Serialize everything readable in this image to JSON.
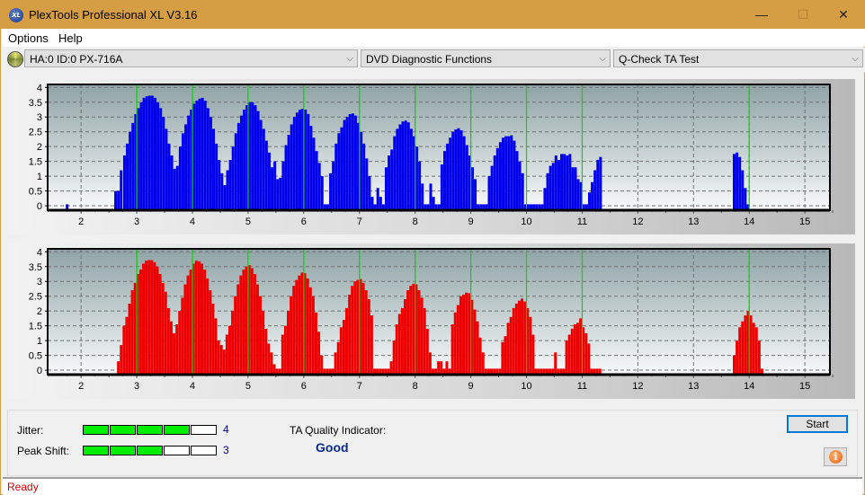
{
  "window": {
    "title": "PlexTools Professional XL V3.16",
    "app_icon_text": "XL",
    "minimize_glyph": "—",
    "maximize_glyph": "☐",
    "close_glyph": "✕",
    "titlebar_color": "#d59d44"
  },
  "menu": {
    "items": [
      {
        "label": "Options"
      },
      {
        "label": "Help"
      }
    ]
  },
  "toolbar": {
    "drive_select": {
      "value": "HA:0 ID:0  PX-716A"
    },
    "function_select": {
      "value": "DVD Diagnostic Functions"
    },
    "test_select": {
      "value": "Q-Check TA Test"
    },
    "chevron_glyph": "⌵"
  },
  "chart_data": [
    {
      "type": "bar",
      "title": "",
      "xlabel": "",
      "ylabel": "",
      "xlim": [
        1.4,
        15.45
      ],
      "ylim": [
        -0.15,
        4.1
      ],
      "x_ticks": [
        2,
        3,
        4,
        5,
        6,
        7,
        8,
        9,
        10,
        11,
        12,
        13,
        14,
        15
      ],
      "y_ticks": [
        0,
        0.5,
        1,
        1.5,
        2,
        2.5,
        3,
        3.5,
        4
      ],
      "y_tick_labels": [
        "0",
        "0.5",
        "1",
        "1.5",
        "2",
        "2.5",
        "3",
        "3.5",
        "4"
      ],
      "grid": true,
      "bar_color": "#0000ee",
      "reference_lines": [
        3,
        4,
        5,
        6,
        7,
        8,
        9,
        10,
        11,
        14
      ],
      "reference_line_color": "#00dd00",
      "series": [
        {
          "name": "Jitter distribution (blue)",
          "x": [
            1.75,
            2.62,
            2.67,
            2.72,
            2.78,
            2.83,
            2.88,
            2.93,
            2.98,
            3.03,
            3.08,
            3.13,
            3.18,
            3.23,
            3.28,
            3.33,
            3.38,
            3.43,
            3.48,
            3.53,
            3.58,
            3.63,
            3.68,
            3.73,
            3.78,
            3.83,
            3.88,
            3.93,
            3.98,
            4.03,
            4.08,
            4.13,
            4.18,
            4.23,
            4.28,
            4.33,
            4.38,
            4.43,
            4.48,
            4.53,
            4.58,
            4.63,
            4.68,
            4.73,
            4.78,
            4.83,
            4.88,
            4.93,
            4.98,
            5.03,
            5.08,
            5.13,
            5.18,
            5.23,
            5.28,
            5.33,
            5.38,
            5.43,
            5.48,
            5.53,
            5.58,
            5.63,
            5.68,
            5.73,
            5.78,
            5.83,
            5.88,
            5.93,
            5.98,
            6.03,
            6.08,
            6.13,
            6.18,
            6.23,
            6.28,
            6.33,
            6.38,
            6.43,
            6.48,
            6.53,
            6.58,
            6.63,
            6.68,
            6.73,
            6.78,
            6.83,
            6.88,
            6.93,
            6.98,
            7.03,
            7.08,
            7.13,
            7.18,
            7.23,
            7.28,
            7.33,
            7.38,
            7.43,
            7.48,
            7.53,
            7.58,
            7.63,
            7.68,
            7.73,
            7.78,
            7.83,
            7.88,
            7.93,
            7.98,
            8.03,
            8.08,
            8.13,
            8.18,
            8.23,
            8.28,
            8.33,
            8.38,
            8.43,
            8.48,
            8.53,
            8.58,
            8.63,
            8.68,
            8.73,
            8.78,
            8.83,
            8.88,
            8.93,
            8.98,
            9.03,
            9.08,
            9.13,
            9.18,
            9.23,
            9.28,
            9.33,
            9.38,
            9.43,
            9.48,
            9.53,
            9.58,
            9.63,
            9.68,
            9.73,
            9.78,
            9.83,
            9.88,
            9.93,
            9.98,
            10.03,
            10.08,
            10.13,
            10.18,
            10.23,
            10.28,
            10.33,
            10.38,
            10.43,
            10.48,
            10.53,
            10.58,
            10.63,
            10.68,
            10.73,
            10.78,
            10.83,
            10.88,
            10.93,
            10.98,
            11.03,
            11.08,
            11.13,
            11.18,
            11.23,
            11.28,
            11.33,
            13.73,
            13.78,
            13.83,
            13.88,
            13.93,
            13.98,
            14.03,
            14.08,
            14.13,
            14.18,
            14.23
          ],
          "values": [
            0.05,
            0.5,
            0.5,
            1.2,
            1.7,
            2.1,
            2.5,
            2.8,
            3.1,
            3.3,
            3.5,
            3.65,
            3.7,
            3.72,
            3.72,
            3.65,
            3.5,
            3.3,
            3.0,
            2.6,
            2.1,
            1.7,
            1.25,
            1.35,
            2.0,
            2.45,
            2.75,
            3.05,
            3.25,
            3.45,
            3.55,
            3.62,
            3.65,
            3.55,
            3.3,
            3.0,
            2.6,
            2.1,
            1.55,
            1.1,
            0.7,
            1.2,
            1.55,
            2.0,
            2.45,
            2.8,
            3.05,
            3.25,
            3.4,
            3.5,
            3.5,
            3.4,
            3.2,
            2.9,
            2.6,
            2.2,
            1.8,
            1.3,
            1.5,
            0.9,
            0.95,
            1.5,
            2.05,
            2.4,
            2.75,
            3.0,
            3.15,
            3.25,
            3.28,
            3.25,
            3.1,
            2.7,
            2.3,
            1.85,
            1.45,
            1.0,
            0.05,
            0.05,
            1.1,
            1.5,
            2.1,
            2.45,
            2.65,
            2.9,
            3.0,
            3.1,
            3.12,
            3.05,
            2.8,
            2.5,
            2.1,
            1.6,
            1.0,
            0.3,
            0.05,
            0.6,
            0.3,
            0.05,
            1.3,
            1.7,
            1.9,
            2.35,
            2.6,
            2.75,
            2.85,
            2.88,
            2.82,
            2.6,
            2.35,
            2.0,
            1.5,
            0.75,
            0.05,
            0.05,
            0.75,
            0.3,
            0.05,
            0.05,
            1.4,
            1.85,
            2.1,
            2.3,
            2.5,
            2.58,
            2.62,
            2.55,
            2.35,
            2.05,
            1.7,
            1.3,
            0.9,
            0.05,
            0.05,
            0.05,
            0.05,
            1.0,
            1.35,
            1.7,
            1.95,
            2.15,
            2.3,
            2.35,
            2.35,
            2.38,
            2.2,
            1.85,
            1.5,
            1.1,
            0.05,
            0.05,
            0.05,
            0.05,
            0.05,
            0.05,
            0.05,
            0.6,
            1.1,
            1.35,
            1.45,
            1.7,
            1.55,
            1.75,
            1.75,
            1.7,
            1.75,
            1.3,
            1.3,
            0.9,
            0.8,
            0.05,
            0.05,
            0.45,
            0.8,
            1.2,
            1.55,
            1.65,
            1.75,
            1.8,
            1.65,
            1.2,
            0.6,
            0.05
          ]
        }
      ]
    },
    {
      "type": "bar",
      "title": "",
      "xlabel": "",
      "ylabel": "",
      "xlim": [
        1.4,
        15.45
      ],
      "ylim": [
        -0.15,
        4.1
      ],
      "x_ticks": [
        2,
        3,
        4,
        5,
        6,
        7,
        8,
        9,
        10,
        11,
        12,
        13,
        14,
        15
      ],
      "y_ticks": [
        0,
        0.5,
        1,
        1.5,
        2,
        2.5,
        3,
        3.5,
        4
      ],
      "y_tick_labels": [
        "0",
        "0.5",
        "1",
        "1.5",
        "2",
        "2.5",
        "3",
        "3.5",
        "4"
      ],
      "grid": true,
      "bar_color": "#ee0000",
      "reference_lines": [
        3,
        4,
        5,
        6,
        7,
        8,
        9,
        10,
        11,
        14
      ],
      "reference_line_color": "#00dd00",
      "series": [
        {
          "name": "Peak shift distribution (red)",
          "x": [
            2.67,
            2.72,
            2.77,
            2.82,
            2.87,
            2.92,
            2.97,
            3.02,
            3.07,
            3.12,
            3.17,
            3.22,
            3.27,
            3.32,
            3.37,
            3.42,
            3.47,
            3.52,
            3.57,
            3.62,
            3.67,
            3.72,
            3.77,
            3.82,
            3.87,
            3.92,
            3.97,
            4.02,
            4.07,
            4.12,
            4.17,
            4.22,
            4.27,
            4.32,
            4.37,
            4.42,
            4.47,
            4.52,
            4.57,
            4.62,
            4.67,
            4.72,
            4.77,
            4.82,
            4.87,
            4.92,
            4.97,
            5.02,
            5.07,
            5.12,
            5.17,
            5.22,
            5.27,
            5.32,
            5.37,
            5.42,
            5.47,
            5.52,
            5.57,
            5.62,
            5.67,
            5.72,
            5.77,
            5.82,
            5.87,
            5.92,
            5.97,
            6.02,
            6.07,
            6.12,
            6.17,
            6.22,
            6.27,
            6.32,
            6.37,
            6.42,
            6.47,
            6.52,
            6.57,
            6.62,
            6.67,
            6.72,
            6.77,
            6.82,
            6.87,
            6.92,
            6.97,
            7.02,
            7.07,
            7.12,
            7.17,
            7.22,
            7.27,
            7.32,
            7.37,
            7.42,
            7.47,
            7.52,
            7.57,
            7.62,
            7.67,
            7.72,
            7.77,
            7.82,
            7.87,
            7.92,
            7.97,
            8.02,
            8.07,
            8.12,
            8.17,
            8.22,
            8.27,
            8.32,
            8.37,
            8.42,
            8.47,
            8.52,
            8.57,
            8.62,
            8.67,
            8.72,
            8.77,
            8.82,
            8.87,
            8.92,
            8.97,
            9.02,
            9.07,
            9.12,
            9.17,
            9.22,
            9.27,
            9.32,
            9.37,
            9.42,
            9.47,
            9.52,
            9.57,
            9.62,
            9.67,
            9.72,
            9.77,
            9.82,
            9.87,
            9.92,
            9.97,
            10.02,
            10.07,
            10.12,
            10.17,
            10.22,
            10.27,
            10.32,
            10.37,
            10.42,
            10.47,
            10.52,
            10.57,
            10.62,
            10.67,
            10.72,
            10.77,
            10.82,
            10.87,
            10.92,
            10.97,
            11.02,
            11.07,
            11.12,
            11.17,
            11.22,
            11.27,
            11.32,
            13.73,
            13.78,
            13.83,
            13.88,
            13.93,
            13.98,
            14.03,
            14.08,
            14.13,
            14.18,
            14.23
          ],
          "values": [
            0.3,
            0.85,
            1.5,
            1.8,
            2.25,
            2.7,
            2.95,
            3.25,
            3.4,
            3.6,
            3.7,
            3.72,
            3.72,
            3.65,
            3.5,
            3.25,
            2.95,
            2.65,
            2.1,
            1.65,
            1.25,
            1.55,
            2.0,
            2.45,
            2.9,
            3.2,
            3.4,
            3.6,
            3.7,
            3.68,
            3.6,
            3.4,
            3.1,
            2.7,
            2.25,
            1.75,
            1.0,
            0.85,
            0.7,
            1.2,
            1.5,
            2.0,
            2.5,
            2.9,
            3.2,
            3.4,
            3.5,
            3.55,
            3.45,
            3.25,
            2.9,
            2.5,
            2.0,
            1.4,
            0.9,
            0.6,
            0.2,
            0.05,
            0.05,
            1.2,
            1.5,
            2.0,
            2.5,
            2.85,
            3.05,
            3.2,
            3.3,
            3.28,
            3.1,
            2.8,
            2.5,
            1.95,
            1.3,
            0.5,
            0.05,
            0.05,
            0.05,
            0.05,
            0.6,
            0.95,
            1.45,
            1.7,
            2.1,
            2.55,
            2.85,
            3.0,
            3.05,
            3.08,
            2.95,
            2.7,
            2.4,
            1.85,
            0.05,
            0.05,
            0.05,
            0.05,
            0.05,
            0.05,
            0.3,
            1.0,
            1.55,
            1.9,
            2.1,
            2.4,
            2.7,
            2.85,
            2.92,
            2.9,
            2.7,
            2.45,
            2.1,
            1.4,
            0.6,
            0.05,
            0.05,
            0.3,
            0.3,
            0.05,
            0.3,
            0.05,
            1.55,
            1.95,
            2.2,
            2.5,
            2.55,
            2.62,
            2.6,
            2.38,
            2.05,
            1.65,
            1.1,
            0.6,
            0.05,
            0.05,
            0.05,
            0.05,
            0.05,
            0.05,
            0.95,
            1.15,
            1.6,
            1.8,
            2.1,
            2.25,
            2.35,
            2.42,
            2.32,
            2.1,
            1.8,
            1.2,
            0.05,
            0.05,
            0.05,
            0.05,
            0.05,
            0.05,
            0.05,
            0.6,
            0.05,
            0.05,
            0.05,
            1.0,
            1.2,
            1.4,
            1.55,
            1.6,
            1.75,
            1.45,
            1.25,
            0.9,
            0.05,
            0.05,
            0.05,
            0.05,
            0.5,
            1.0,
            1.45,
            1.65,
            1.85,
            2.0,
            1.85,
            1.6,
            1.45,
            1.0,
            0.05
          ]
        }
      ]
    }
  ],
  "metrics": {
    "jitter": {
      "label": "Jitter:",
      "value": "4",
      "filled": 4,
      "total": 5
    },
    "peak_shift": {
      "label": "Peak Shift:",
      "value": "3",
      "filled": 3,
      "total": 5
    },
    "ta_quality_label": "TA Quality Indicator:",
    "ta_quality_value": "Good",
    "meter_on_color": "#00ee00"
  },
  "buttons": {
    "start_label": "Start",
    "info_glyph": "i"
  },
  "status": {
    "text": "Ready",
    "color": "#e00000"
  }
}
